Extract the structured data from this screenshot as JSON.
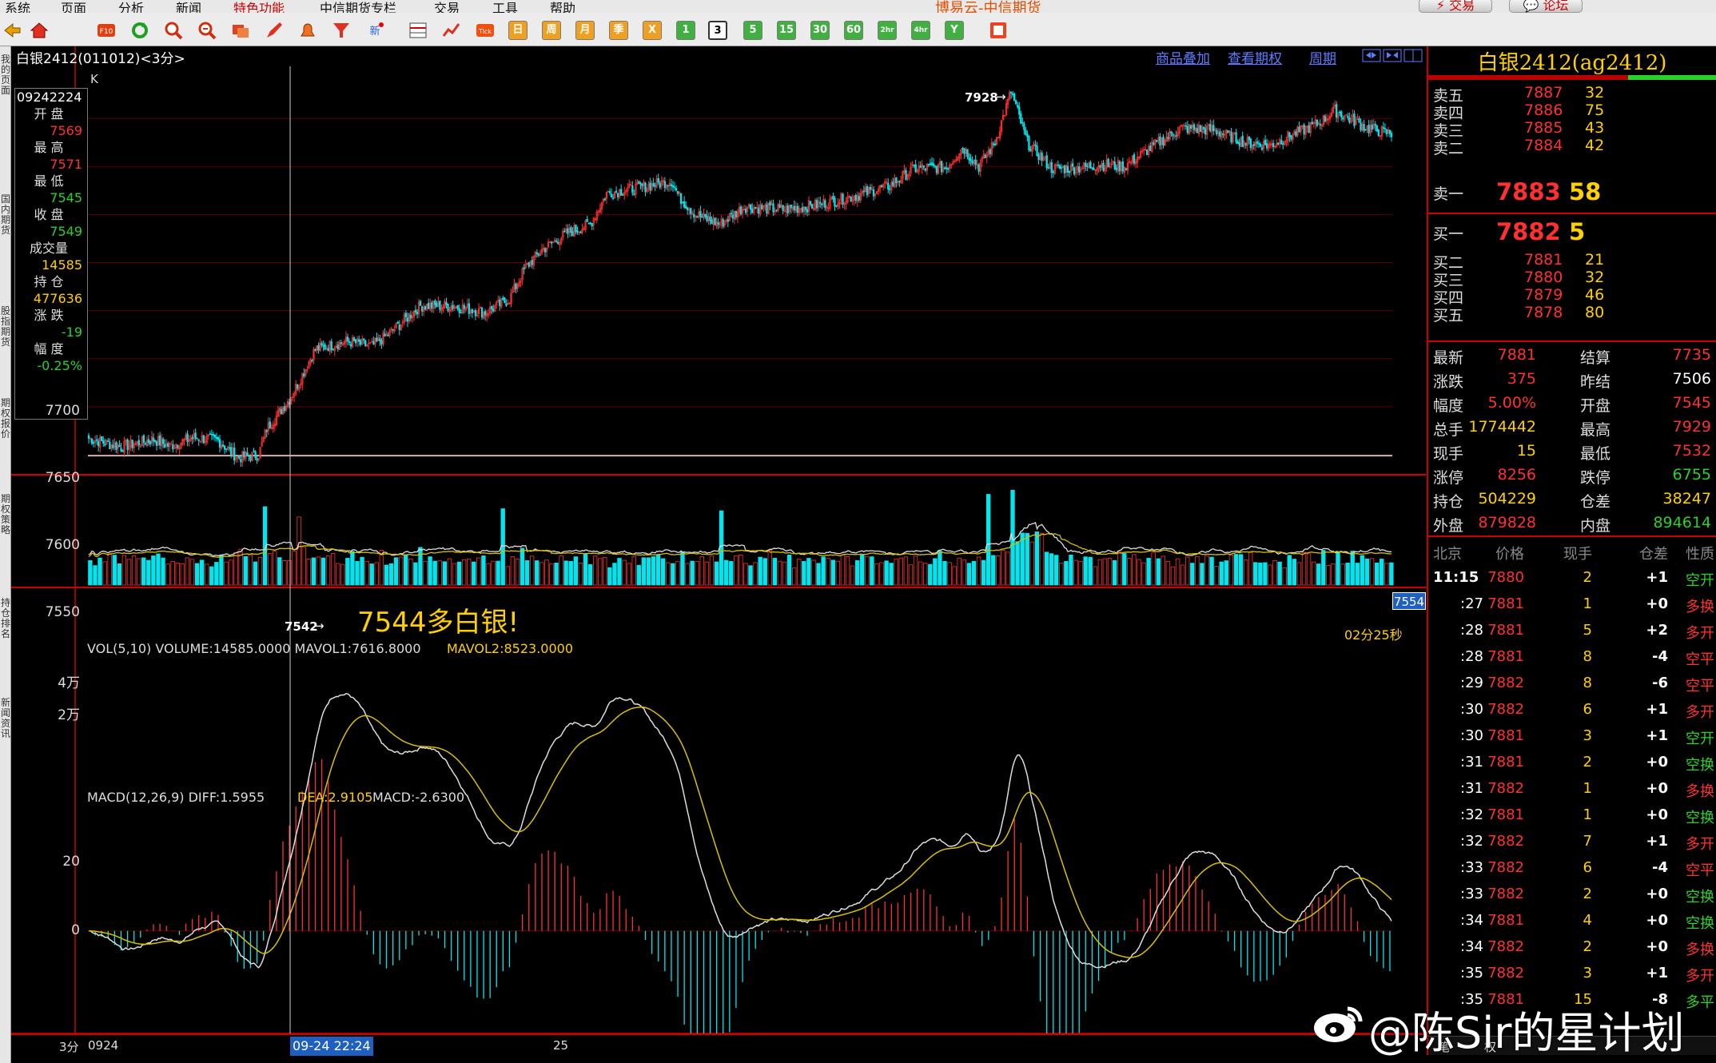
{
  "menu": {
    "items": [
      "系统",
      "页面",
      "分析",
      "新闻",
      "特色功能",
      "中信期货专栏",
      "交易",
      "工具",
      "帮助"
    ],
    "window_title": "博易云-中信期货",
    "trade_btn": "⚡ 交易",
    "forum_btn": "💬 论坛"
  },
  "toolbar": {
    "periods": [
      "3",
      "5",
      "15",
      "30",
      "60",
      "2hr",
      "4hr",
      "Y"
    ],
    "selected_period": "3",
    "kbtns": [
      "日",
      "周",
      "月",
      "季",
      "X",
      "1"
    ]
  },
  "leftstrip": {
    "tabs": [
      "我的页面",
      "国内期货",
      "股指期货",
      "期权报价",
      "期权策略",
      "持仓排名",
      "新闻资讯"
    ]
  },
  "chart": {
    "title": "白银2412(011012)<3分>",
    "links": [
      "商品叠加",
      "查看期权",
      "周期"
    ],
    "infobox": {
      "date": "09242224",
      "rows": [
        {
          "label": "开 盘",
          "value": "7569",
          "color": "#ff3030"
        },
        {
          "label": "最 高",
          "value": "7571",
          "color": "#ff3030"
        },
        {
          "label": "最 低",
          "value": "7545",
          "color": "#2ad12a"
        },
        {
          "label": "收 盘",
          "value": "7549",
          "color": "#2ad12a"
        },
        {
          "label": "成交量",
          "value": "14585",
          "color": "#ffd000"
        },
        {
          "label": "持 仓",
          "value": "477636",
          "color": "#ffd000"
        },
        {
          "label": "涨 跌",
          "value": "-19",
          "color": "#2ad12a"
        },
        {
          "label": "幅 度",
          "value": "-0.25%",
          "color": "#2ad12a"
        }
      ]
    },
    "k_marker": "K",
    "high_label": "7928",
    "low_label": "7542",
    "annotation": "7544多白银!",
    "price_tag": "7554",
    "countdown": "02分25秒",
    "y_ticks": [
      "7700",
      "7650",
      "7600",
      "7550"
    ],
    "vol": {
      "legend_main": "VOL(5,10) VOLUME:14585.0000 MAVOL1:7616.8000",
      "legend_ma2": "MAVOL2:8523.0000",
      "y_ticks": [
        "4万",
        "2万"
      ]
    },
    "macd": {
      "legend_main": "MACD(12,26,9) DIFF:1.5955",
      "legend_dea": "DEA:2.9105",
      "legend_macd": "MACD:-2.6300",
      "y_ticks": [
        "20",
        "0"
      ]
    },
    "x_axis": {
      "period_label": "3分",
      "labels": [
        "0924",
        "25"
      ],
      "cursor_label": "09-24 22:24"
    }
  },
  "chart_data": {
    "type": "candlestick",
    "title": "白银2412(011012)<3分>",
    "ylim": [
      7530,
      7950
    ],
    "y_ticks": [
      7550,
      7600,
      7650,
      7700
    ],
    "x_labels": [
      "0924",
      "25"
    ],
    "annotations": [
      "7928",
      "7542",
      "7544多白银!"
    ],
    "series": [
      {
        "name": "VOL(5,10)"
      },
      {
        "name": "MACD(12,26,9)"
      }
    ],
    "vol_ylim": [
      0,
      50000
    ],
    "vol_ticks": [
      20000,
      40000
    ],
    "macd_ylim": [
      -10,
      30
    ],
    "macd_ticks": [
      0,
      20
    ]
  },
  "quote": {
    "title": "白银2412(ag2412)",
    "asks": [
      {
        "label": "卖五",
        "price": "7887",
        "vol": "32"
      },
      {
        "label": "卖四",
        "price": "7886",
        "vol": "75"
      },
      {
        "label": "卖三",
        "price": "7885",
        "vol": "43"
      },
      {
        "label": "卖二",
        "price": "7884",
        "vol": "42"
      },
      {
        "label": "卖一",
        "price": "7883",
        "vol": "58"
      }
    ],
    "bids": [
      {
        "label": "买一",
        "price": "7882",
        "vol": "5"
      },
      {
        "label": "买二",
        "price": "7881",
        "vol": "21"
      },
      {
        "label": "买三",
        "price": "7880",
        "vol": "32"
      },
      {
        "label": "买四",
        "price": "7879",
        "vol": "46"
      },
      {
        "label": "买五",
        "price": "7878",
        "vol": "80"
      }
    ],
    "stats": [
      {
        "l1": "最新",
        "v1": "7881",
        "c1": "#ff3030",
        "l2": "结算",
        "v2": "7735",
        "c2": "#ff3030"
      },
      {
        "l1": "涨跌",
        "v1": "375",
        "c1": "#ff3030",
        "l2": "昨结",
        "v2": "7506",
        "c2": "#ffffff"
      },
      {
        "l1": "幅度",
        "v1": "5.00%",
        "c1": "#ff3030",
        "l2": "开盘",
        "v2": "7545",
        "c2": "#ff3030"
      },
      {
        "l1": "总手",
        "v1": "1774442",
        "c1": "#ffd000",
        "l2": "最高",
        "v2": "7929",
        "c2": "#ff3030"
      },
      {
        "l1": "现手",
        "v1": "15",
        "c1": "#ffd000",
        "l2": "最低",
        "v2": "7532",
        "c2": "#ff3030"
      },
      {
        "l1": "涨停",
        "v1": "8256",
        "c1": "#ff3030",
        "l2": "跌停",
        "v2": "6755",
        "c2": "#2ad12a"
      },
      {
        "l1": "持仓",
        "v1": "504229",
        "c1": "#ffd000",
        "l2": "仓差",
        "v2": "38247",
        "c2": "#ffd000"
      },
      {
        "l1": "外盘",
        "v1": "879828",
        "c1": "#ff3030",
        "l2": "内盘",
        "v2": "894614",
        "c2": "#2ad12a"
      }
    ],
    "tick_headers": [
      "北京",
      "价格",
      "现手",
      "仓差",
      "性质"
    ],
    "ticks": [
      {
        "t": "11:15",
        "p": "7880",
        "v": "2",
        "d": "+1",
        "n": "空开",
        "nc": "#2ad12a"
      },
      {
        "t": ":27",
        "p": "7881",
        "v": "1",
        "d": "+0",
        "n": "多换",
        "nc": "#ff3030"
      },
      {
        "t": ":28",
        "p": "7881",
        "v": "5",
        "d": "+2",
        "n": "多开",
        "nc": "#ff3030"
      },
      {
        "t": ":28",
        "p": "7881",
        "v": "8",
        "d": "-4",
        "n": "空平",
        "nc": "#ff3030"
      },
      {
        "t": ":29",
        "p": "7882",
        "v": "8",
        "d": "-6",
        "n": "空平",
        "nc": "#ff3030"
      },
      {
        "t": ":30",
        "p": "7882",
        "v": "6",
        "d": "+1",
        "n": "多开",
        "nc": "#ff3030"
      },
      {
        "t": ":30",
        "p": "7881",
        "v": "3",
        "d": "+1",
        "n": "空开",
        "nc": "#2ad12a"
      },
      {
        "t": ":31",
        "p": "7881",
        "v": "2",
        "d": "+0",
        "n": "空换",
        "nc": "#2ad12a"
      },
      {
        "t": ":31",
        "p": "7882",
        "v": "1",
        "d": "+0",
        "n": "多换",
        "nc": "#ff3030"
      },
      {
        "t": ":32",
        "p": "7881",
        "v": "1",
        "d": "+0",
        "n": "空换",
        "nc": "#2ad12a"
      },
      {
        "t": ":32",
        "p": "7882",
        "v": "7",
        "d": "+1",
        "n": "多开",
        "nc": "#ff3030"
      },
      {
        "t": ":33",
        "p": "7882",
        "v": "6",
        "d": "-4",
        "n": "空平",
        "nc": "#ff3030"
      },
      {
        "t": ":33",
        "p": "7882",
        "v": "2",
        "d": "+0",
        "n": "空换",
        "nc": "#2ad12a"
      },
      {
        "t": ":34",
        "p": "7881",
        "v": "4",
        "d": "+0",
        "n": "空换",
        "nc": "#2ad12a"
      },
      {
        "t": ":34",
        "p": "7882",
        "v": "2",
        "d": "+0",
        "n": "多换",
        "nc": "#ff3030"
      },
      {
        "t": ":35",
        "p": "7882",
        "v": "3",
        "d": "+1",
        "n": "多开",
        "nc": "#ff3030"
      },
      {
        "t": ":35",
        "p": "7881",
        "v": "15",
        "d": "-8",
        "n": "多平",
        "nc": "#2ad12a"
      }
    ],
    "bottom_tabs": [
      "笔",
      "权"
    ]
  },
  "watermark": "@陈Sir的星计划"
}
